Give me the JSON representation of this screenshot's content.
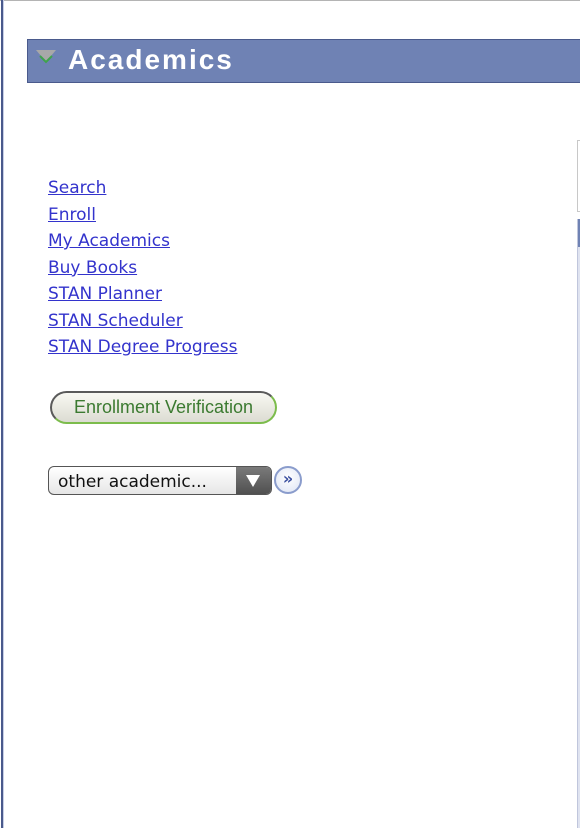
{
  "header": {
    "title": "Academics",
    "toggle_icon": "collapse-triangle-icon",
    "background_color": "#6f82b4"
  },
  "links": [
    {
      "label": "Search"
    },
    {
      "label": "Enroll"
    },
    {
      "label": "My Academics"
    },
    {
      "label": "Buy Books"
    },
    {
      "label": "STAN Planner"
    },
    {
      "label": "STAN Scheduler"
    },
    {
      "label": "STAN Degree Progress"
    }
  ],
  "enrollment_button": {
    "label": "Enrollment Verification",
    "text_color": "#3b7a30"
  },
  "other_select": {
    "selected_value": "other academic...",
    "go_icon": "double-chevron-right-icon",
    "go_glyph": "»"
  },
  "colors": {
    "link": "#3333cc",
    "border": "#4a5a8c"
  }
}
